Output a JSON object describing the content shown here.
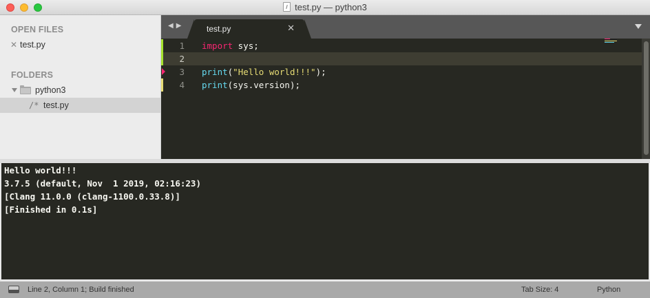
{
  "window": {
    "title": "test.py — python3"
  },
  "sidebar": {
    "open_files_heading": "OPEN FILES",
    "open_files": [
      {
        "label": "test.py"
      }
    ],
    "folders_heading": "FOLDERS",
    "folder": {
      "label": "python3",
      "expanded": true
    },
    "folder_files": [
      {
        "label": "test.py",
        "selected": true
      }
    ]
  },
  "tabs": [
    {
      "label": "test.py",
      "active": true
    }
  ],
  "editor": {
    "lines": [
      {
        "number": "1",
        "code": "import sys;"
      },
      {
        "number": "2",
        "code": ""
      },
      {
        "number": "3",
        "code": "print(\"Hello world!!!\");"
      },
      {
        "number": "4",
        "code": "print(sys.version);"
      }
    ],
    "current_line": 2
  },
  "output": {
    "lines": [
      "Hello world!!!",
      "3.7.5 (default, Nov  1 2019, 02:16:23)",
      "[Clang 11.0.0 (clang-1100.0.33.8)]",
      "[Finished in 0.1s]"
    ]
  },
  "status": {
    "position": "Line 2, Column 1; Build finished",
    "tab_size": "Tab Size: 4",
    "syntax": "Python"
  },
  "colors": {
    "editor_bg": "#272822",
    "keyword": "#f92672",
    "function": "#66d9ef",
    "string": "#e6db74",
    "line_number": "#8f908a",
    "current_line": "#3e3d32"
  },
  "icons": {
    "close_file": "x-icon",
    "folder": "folder-icon",
    "file": "file-icon",
    "panel_toggle": "panel-icon",
    "tab_menu": "chevron-down-icon"
  }
}
